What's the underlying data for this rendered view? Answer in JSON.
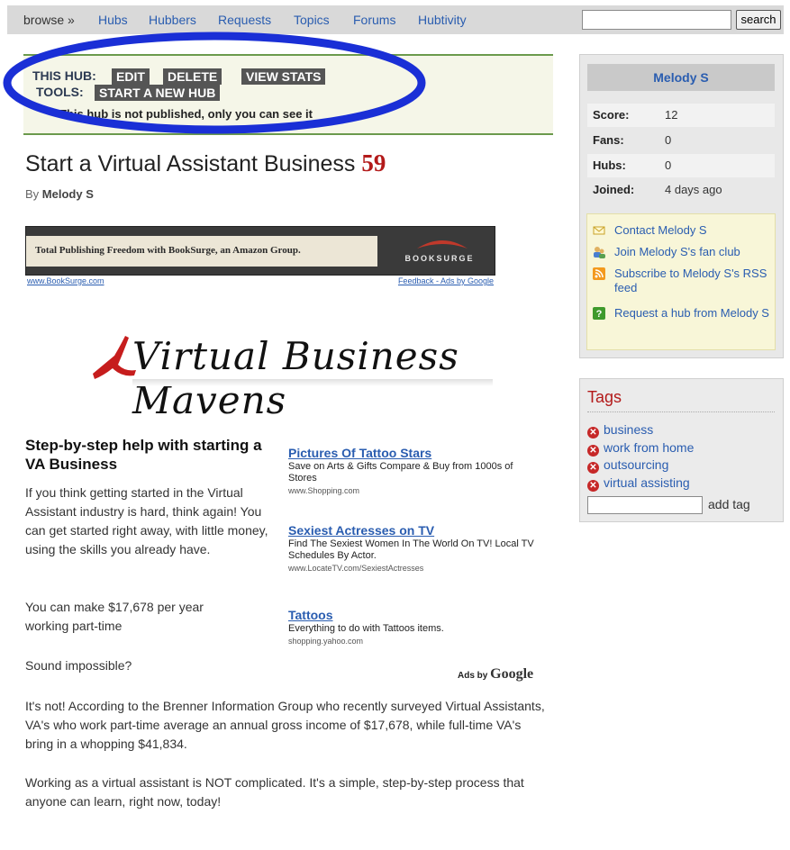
{
  "topbar": {
    "browse": "browse »",
    "nav": [
      "Hubs",
      "Hubbers",
      "Requests",
      "Topics",
      "Forums",
      "Hubtivity"
    ],
    "search_value": "",
    "search_label": "search"
  },
  "hub_tools": {
    "this_hub_label": "THIS HUB:",
    "tools_label": "TOOLS:",
    "edit": "EDIT",
    "delete": "DELETE",
    "view_stats": "VIEW STATS",
    "start_new": "START A NEW HUB",
    "note": "This hub is not published, only you can see it"
  },
  "article": {
    "title": "Start a Virtual Assistant Business",
    "score": "59",
    "by": "By",
    "author": "Melody S",
    "heading": "Step-by-step help with starting a VA Business",
    "p1": "If you think getting started in the Virtual Assistant industry is hard, think again! You can get started right away, with little money, using the skills you already have.",
    "p2": "You can make $17,678 per year working part-time",
    "p3": "Sound impossible?",
    "p4": "It's not! According to the Brenner Information Group who recently surveyed Virtual Assistants, VA's who work part-time average an annual gross income of $17,678, while full-time VA's bring in a whopping $41,834.",
    "p5": "Working as a virtual assistant is NOT complicated. It's a simple, step-by-step process that anyone can learn, right now, today!"
  },
  "banner": {
    "text": "Total Publishing Freedom with BookSurge, an Amazon Group.",
    "brand": "BOOKSURGE",
    "link_left": "www.BookSurge.com",
    "link_right": "Feedback - Ads by Google"
  },
  "logo": {
    "text": "Virtual Business Mavens"
  },
  "ads": [
    {
      "title": "Pictures Of Tattoo Stars",
      "desc": "Save on Arts & Gifts Compare & Buy from 1000s of Stores",
      "url": "www.Shopping.com"
    },
    {
      "title": "Sexiest Actresses on TV",
      "desc": "Find The Sexiest Women In The World On TV! Local TV Schedules By Actor.",
      "url": "www.LocateTV.com/SexiestActresses"
    },
    {
      "title": "Tattoos",
      "desc": "Everything to do with Tattoos items.",
      "url": "shopping.yahoo.com"
    }
  ],
  "ads_by": {
    "prefix": "Ads by",
    "brand": "Google"
  },
  "profile": {
    "name": "Melody S",
    "stats": [
      {
        "label": "Score:",
        "value": "12"
      },
      {
        "label": "Fans:",
        "value": "0"
      },
      {
        "label": "Hubs:",
        "value": "0"
      },
      {
        "label": "Joined:",
        "value": "4 days ago"
      }
    ],
    "actions": [
      "Contact Melody S",
      "Join Melody S's fan club",
      "Subscribe to Melody S's RSS feed",
      "Request a hub from Melody S"
    ]
  },
  "tags": {
    "heading": "Tags",
    "items": [
      "business",
      "work from home",
      "outsourcing",
      "virtual assisting"
    ],
    "input_value": "",
    "add_label": "add tag"
  },
  "colors": {
    "link": "#2a5db0",
    "score_red": "#b31a1a",
    "highlight_ellipse": "#1a2fd6",
    "hubbox_green": "#6b9a4c"
  }
}
